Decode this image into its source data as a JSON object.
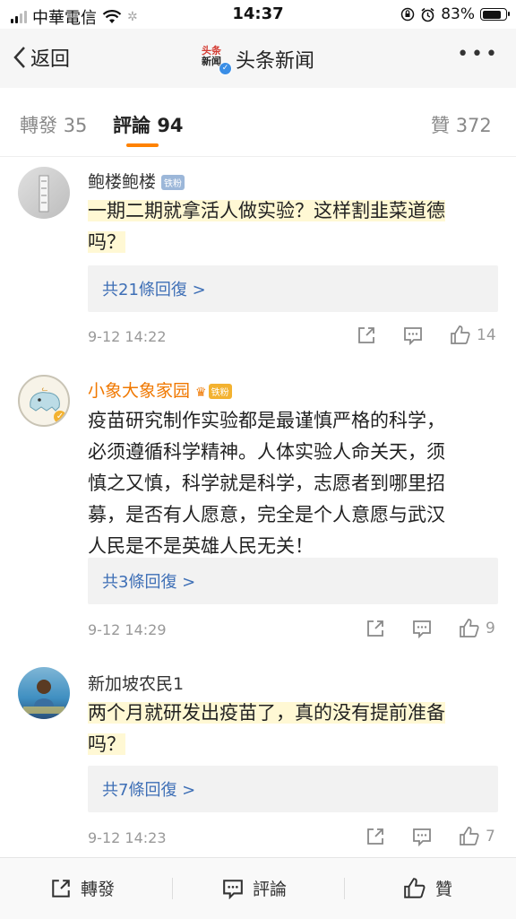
{
  "status_bar": {
    "carrier": "中華電信",
    "time": "14:37",
    "battery": "83%",
    "battery_level": 0.83
  },
  "nav": {
    "back_label": "返回",
    "logo_text_top": "头条",
    "logo_text_bottom": "新闻",
    "title": "头条新闻",
    "more_icon": "more-dots-icon"
  },
  "tabs": [
    {
      "label": "轉發",
      "count": "35"
    },
    {
      "label": "評論",
      "count": "94"
    },
    {
      "label": "贊",
      "count": "372"
    }
  ],
  "comments": [
    {
      "user": "鲍楼鲍楼",
      "badge": "铁粉",
      "lines": [
        "一期二期就拿活人做实验？这样割韭菜道德",
        "吗？"
      ],
      "replies": "共21條回復 >",
      "time": "9-12 14:22",
      "likes": "14"
    },
    {
      "user": "小象大象家园",
      "badge": "铁粉",
      "lines": [
        "疫苗研究制作实验都是最谨慎严格的科学，",
        "必须遵循科学精神。人体实验人命关天，须",
        "慎之又慎，科学就是科学，志愿者到哪里招",
        "募，是否有人愿意，完全是个人意愿与武汉",
        "人民是不是英雄人民无关！"
      ],
      "replies": "共3條回復 >",
      "time": "9-12 14:29",
      "likes": "9"
    },
    {
      "user": "新加坡农民1",
      "badge": "",
      "lines": [
        "两个月就研发出疫苗了，真的没有提前准备",
        "吗？"
      ],
      "replies": "共7條回復 >",
      "time": "9-12 14:23",
      "likes": "7"
    }
  ],
  "bottom_bar": {
    "repost": "轉發",
    "comment": "評論",
    "like": "贊"
  },
  "colors": {
    "accent": "#ff8200",
    "link": "#3e6fb6",
    "vip_name": "#f07800"
  }
}
